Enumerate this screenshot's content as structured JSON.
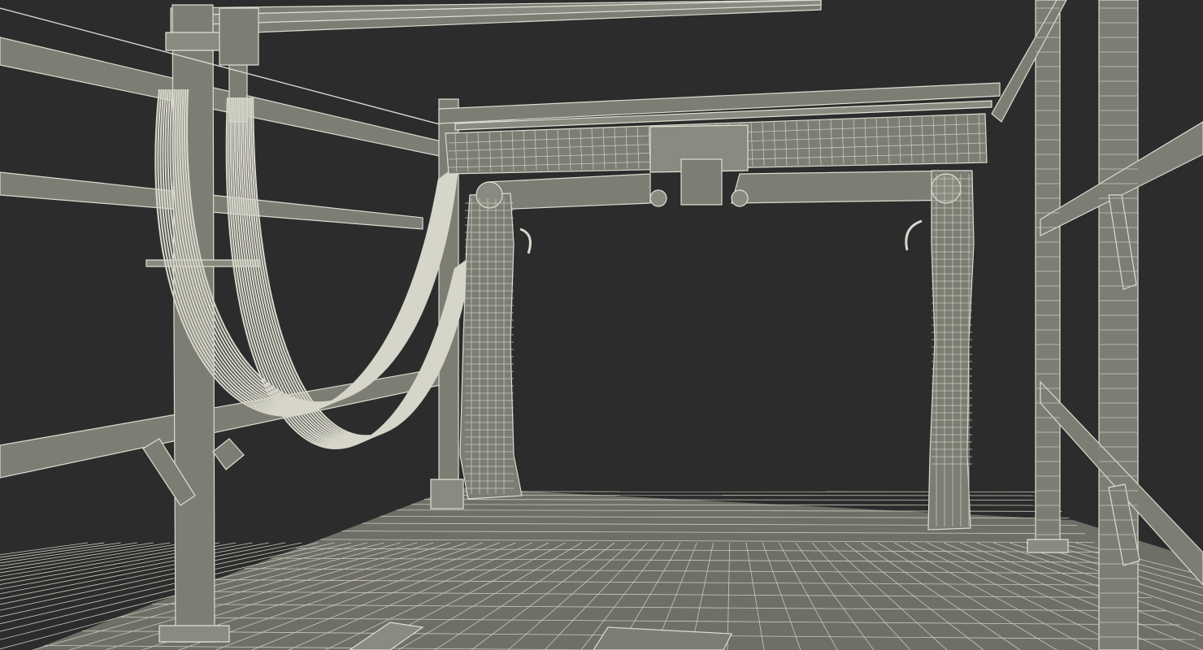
{
  "scene": {
    "background_color": "#2c2c2c",
    "wire_color": "#d9d8cc",
    "surface_color": "#7d7d74",
    "cable_count": 14
  }
}
